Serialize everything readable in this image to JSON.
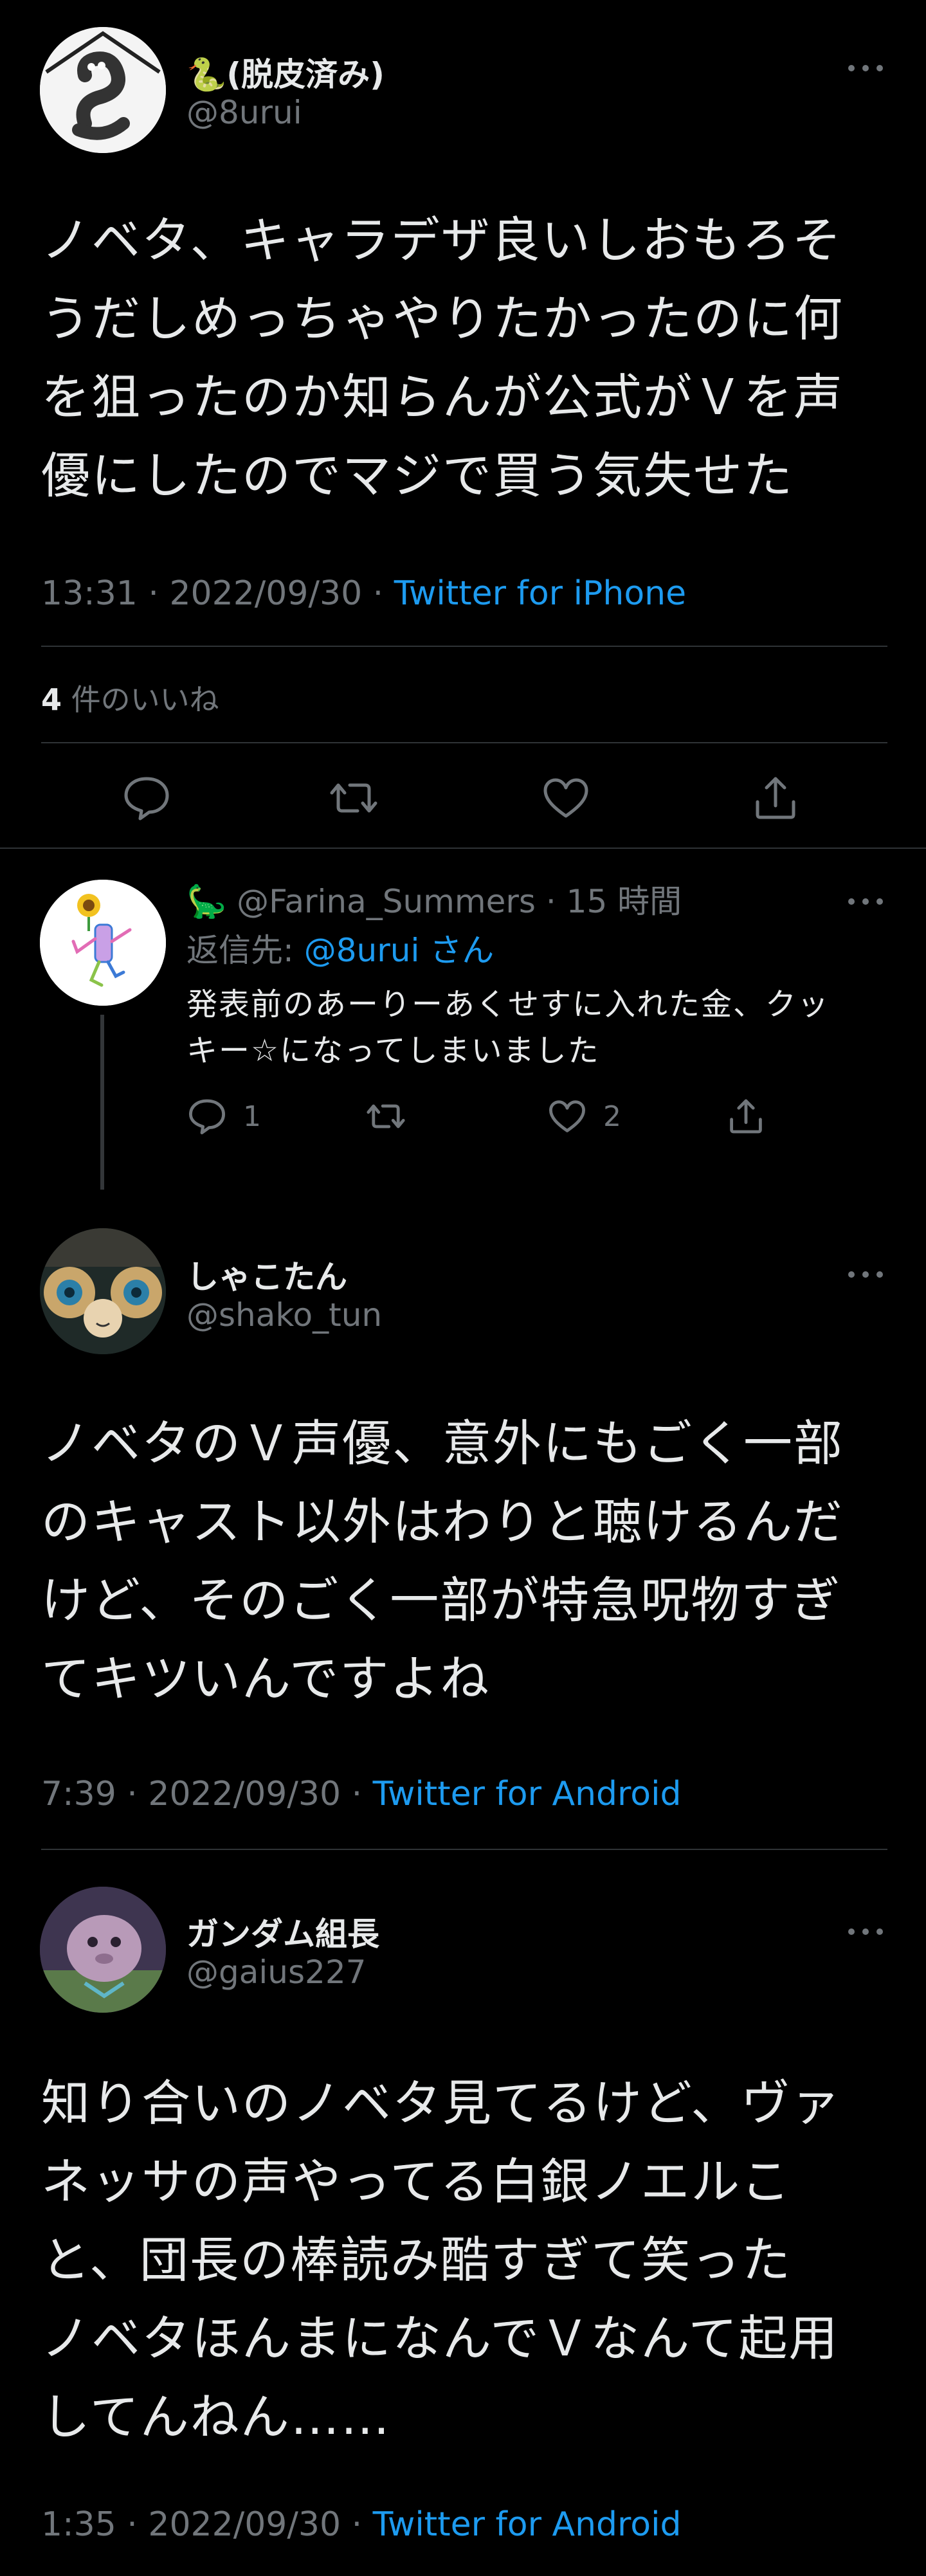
{
  "main_tweet": {
    "display_name": "🐍(脱皮済み)",
    "handle": "@8urui",
    "text": "ノベタ、キャラデザ良いしおもろそ\nうだしめっちゃやりたかったのに何\nを狙ったのか知らんが公式がＶを声\n優にしたのでマジで買う気失せた",
    "time": "13:31 · 2022/09/30 · ",
    "source": "Twitter for iPhone",
    "likes_count": "4",
    "likes_label": " 件のいいね",
    "icons": [
      "reply-icon",
      "retweet-icon",
      "like-icon",
      "share-icon"
    ]
  },
  "reply_tweet": {
    "display_name": "🦕",
    "handle_time": " @Farina_Summers · 15 時間",
    "reply_to_label": "返信先: ",
    "reply_to_handle": "@8urui",
    "reply_to_suffix": " さん",
    "text": "発表前のあーりーあくせすに入れた金、クッ\nキー☆になってしまいました",
    "reply_count": "1",
    "like_count": "2"
  },
  "tweet2": {
    "display_name": "しゃこたん",
    "handle": "@shako_tun",
    "text": "ノベタのＶ声優、意外にもごく一部\nのキャスト以外はわりと聴けるんだ\nけど、そのごく一部が特急呪物すぎ\nてキツいんですよね",
    "time": "7:39 · 2022/09/30 · ",
    "source": "Twitter for Android"
  },
  "tweet3": {
    "display_name": "ガンダム組長",
    "handle": "@gaius227",
    "text": "知り合いのノベタ見てるけど、ヴァ\nネッサの声やってる白銀ノエルこ\nと、団長の棒読み酷すぎて笑った\nノベタほんまになんでＶなんて起用\nしてんねん……",
    "time": "1:35 · 2022/09/30 · ",
    "source": "Twitter for Android"
  },
  "colors": {
    "background": "#000000",
    "text": "#e7e9ea",
    "secondary": "#71767b",
    "link": "#1d9bf0",
    "divider": "#2f3336"
  }
}
